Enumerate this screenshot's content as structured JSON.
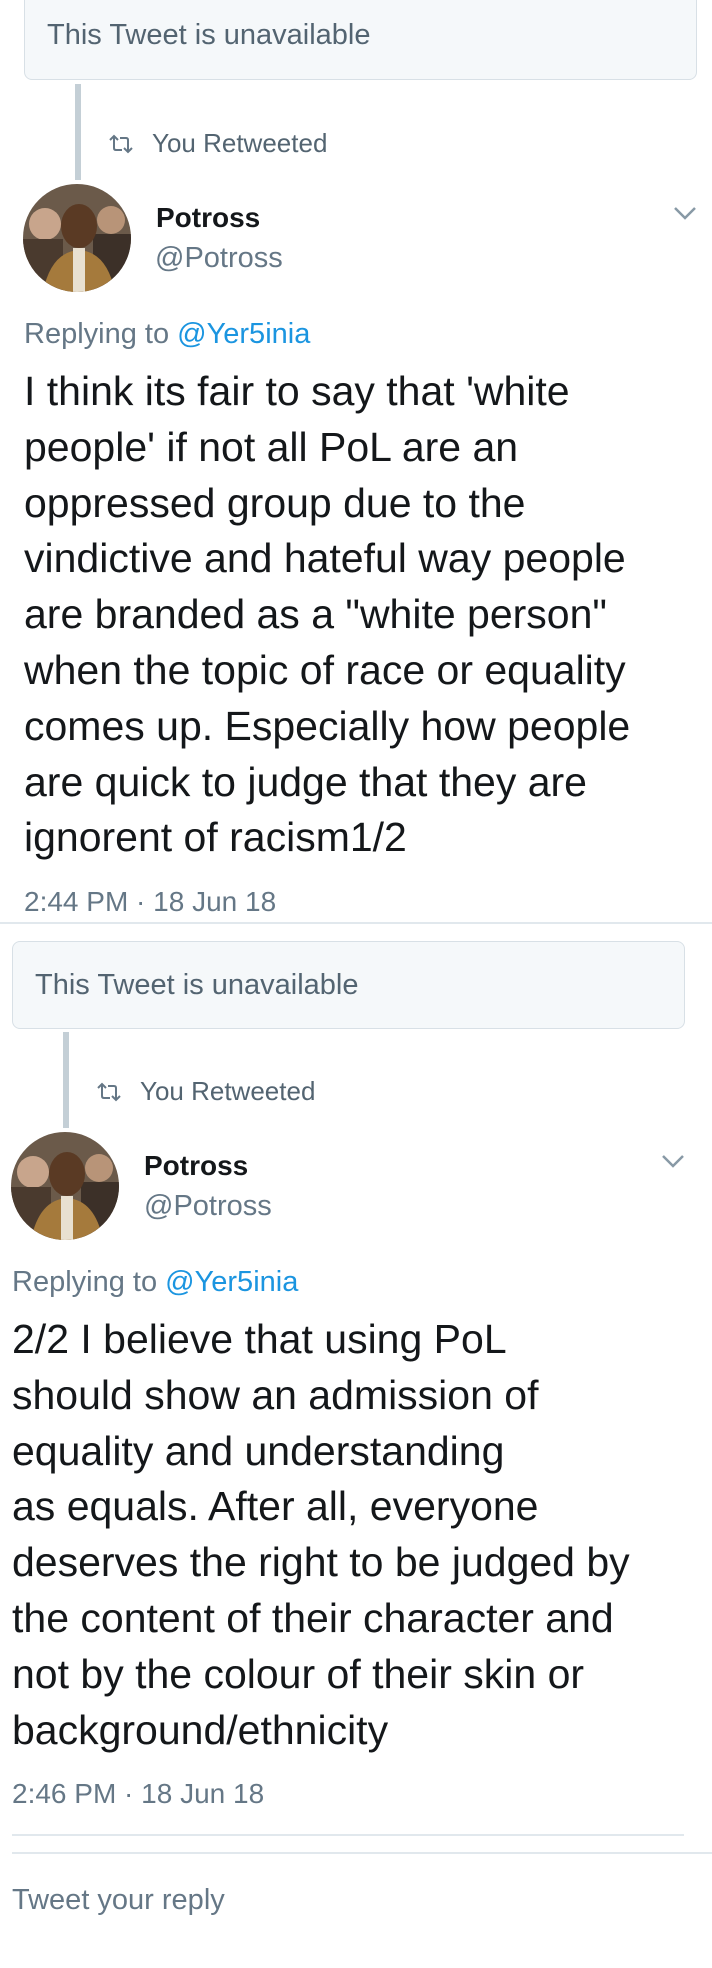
{
  "tweets": [
    {
      "unavailable_text": "This Tweet is unavailable",
      "retweet_label": "You Retweeted",
      "display_name": "Potross",
      "handle": "@Potross",
      "replying_prefix": "Replying to",
      "replying_mention": "@Yer5inia",
      "text": "I think its fair to say that 'white\npeople' if not all PoL are an\noppressed group due to the\nvindictive and hateful way people\nare branded as a \"white person\"\nwhen the topic of race or equality\ncomes up. Especially how people\nare quick to judge that they are\nignorent of racism1/2",
      "timestamp": "2:44 PM · 18 Jun 18"
    },
    {
      "unavailable_text": "This Tweet is unavailable",
      "retweet_label": "You Retweeted",
      "display_name": "Potross",
      "handle": "@Potross",
      "replying_prefix": "Replying to",
      "replying_mention": "@Yer5inia",
      "text": "2/2 I believe that using PoL\nshould show an admission of\nequality and understanding\nas equals. After all, everyone\ndeserves the right to be judged by\nthe content of their character and\nnot by the colour of their skin or\nbackground/ethnicity",
      "timestamp": "2:46 PM · 18 Jun 18"
    }
  ],
  "reply_box": {
    "placeholder": "Tweet your reply"
  },
  "icons": {
    "retweet": "retweet-icon",
    "chevron": "chevron-down-icon",
    "avatar": "avatar-photo"
  },
  "colors": {
    "link": "#1b95e0",
    "secondary_text": "#657786",
    "card_background": "#f5f8fa",
    "thread_line": "#c4cfd6"
  }
}
